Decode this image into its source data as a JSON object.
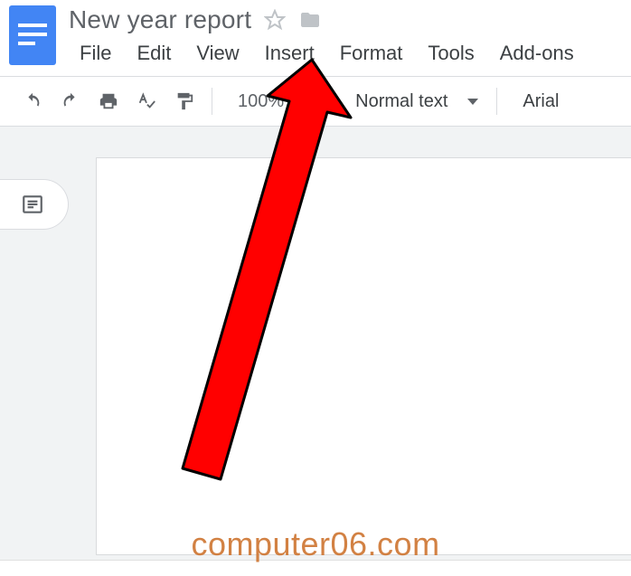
{
  "header": {
    "doc_title": "New year report"
  },
  "menubar": {
    "items": [
      "File",
      "Edit",
      "View",
      "Insert",
      "Format",
      "Tools",
      "Add-ons"
    ]
  },
  "toolbar": {
    "zoom": "100%",
    "paragraph_style": "Normal text",
    "font": "Arial"
  },
  "watermark": "computer06.com"
}
